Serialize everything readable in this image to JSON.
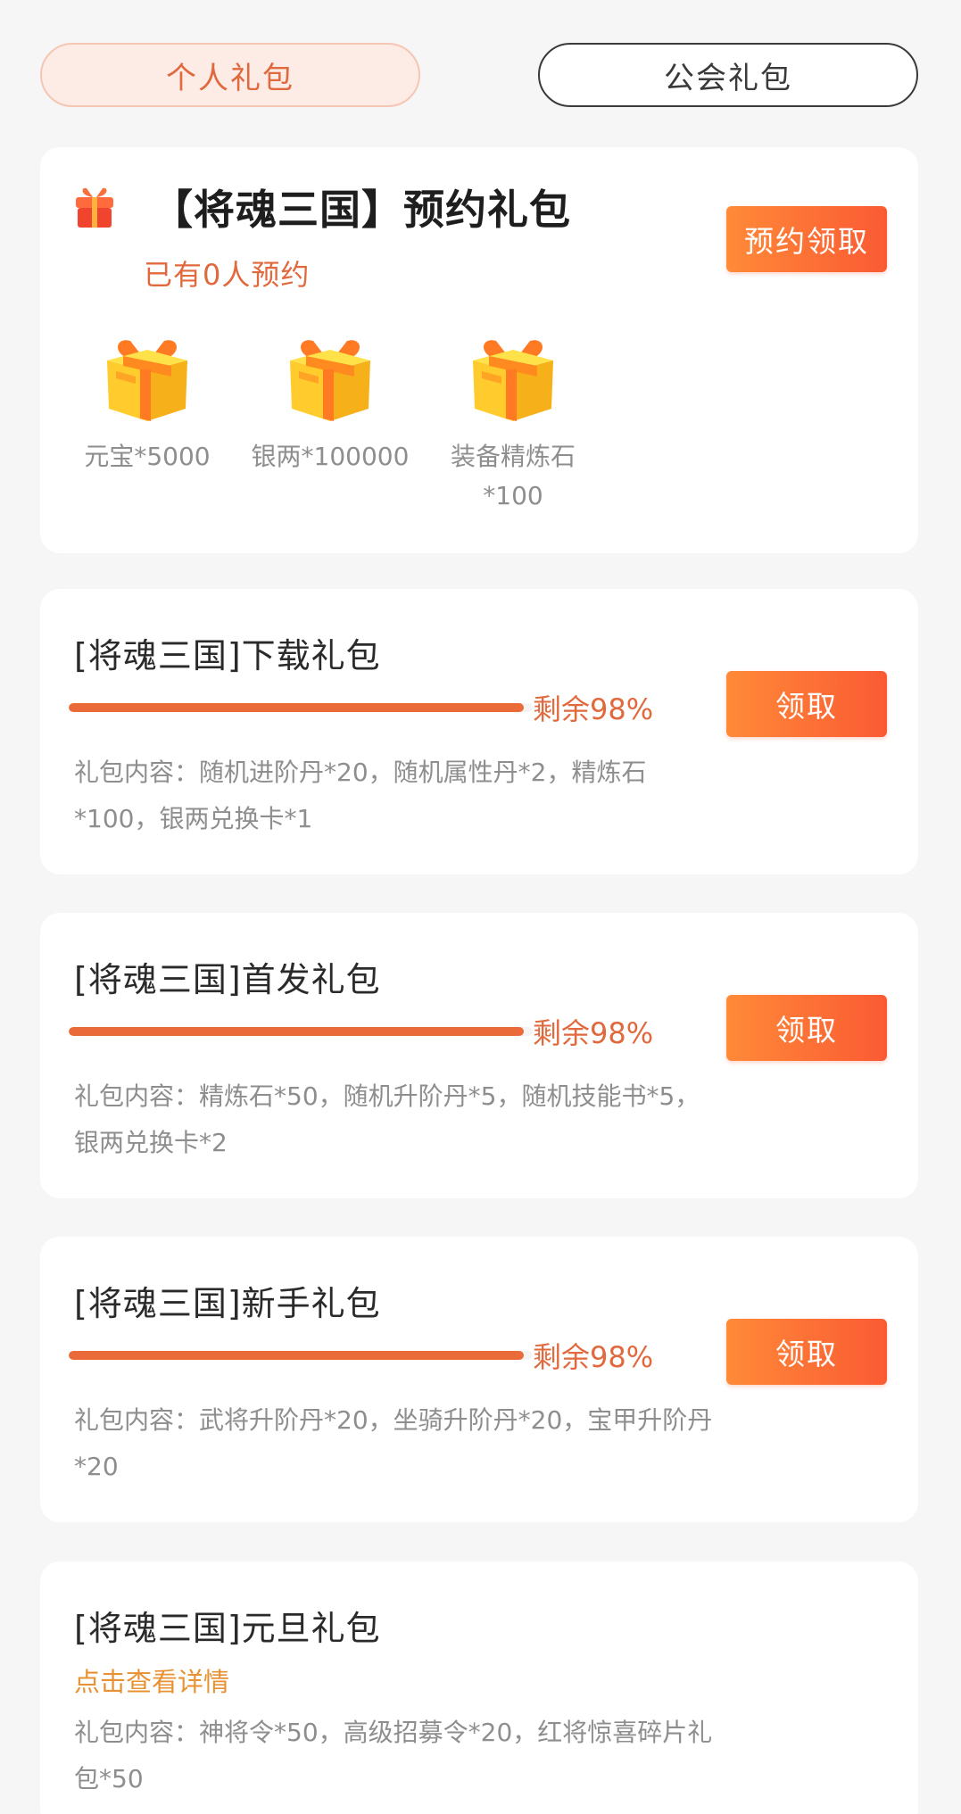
{
  "tabs": {
    "personal": "个人礼包",
    "guild": "公会礼包"
  },
  "reserve": {
    "title": "【将魂三国】预约礼包",
    "count_text": "已有0人预约",
    "button": "预约领取",
    "rewards": [
      {
        "label": "元宝*5000"
      },
      {
        "label": "银两*100000"
      },
      {
        "label": "装备精炼石*100"
      }
    ]
  },
  "packs": [
    {
      "title": "[将魂三国]下载礼包",
      "remain": "剩余98%",
      "remain_fraction": 0.98,
      "content": "礼包内容：随机进阶丹*20，随机属性丹*2，精炼石*100，银两兑换卡*1",
      "button": "领取"
    },
    {
      "title": "[将魂三国]首发礼包",
      "remain": "剩余98%",
      "remain_fraction": 0.98,
      "content": "礼包内容：精炼石*50，随机升阶丹*5，随机技能书*5，银两兑换卡*2",
      "button": "领取"
    },
    {
      "title": "[将魂三国]新手礼包",
      "remain": "剩余98%",
      "remain_fraction": 0.98,
      "content": "礼包内容：武将升阶丹*20，坐骑升阶丹*20，宝甲升阶丹*20",
      "button": "领取"
    },
    {
      "title": "[将魂三国]元旦礼包",
      "detail_link": "点击查看详情",
      "content": "礼包内容：神将令*50，高级招募令*20，红将惊喜碎片礼包*50"
    }
  ],
  "colors": {
    "accent": "#e0693e",
    "button_start": "#ff8a38",
    "button_end": "#fa5a33",
    "detail_link": "#e89132"
  }
}
